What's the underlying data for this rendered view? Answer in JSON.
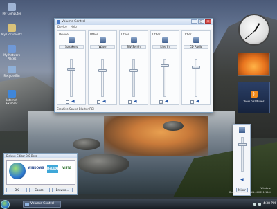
{
  "desktop_icons": [
    {
      "label": "My Computer",
      "color": "#9fb4d4"
    },
    {
      "label": "My Documents",
      "color": "#d9c27a"
    },
    {
      "label": "My Network Places",
      "color": "#6f98d6"
    },
    {
      "label": "Recycle Bin",
      "color": "#8fb0d8"
    },
    {
      "label": "Internet Explorer",
      "color": "#3f86d9"
    }
  ],
  "volume_window": {
    "title": "Volume Control",
    "menu": [
      "Device",
      "Help"
    ],
    "status": "Creative Sound Blaster PCI",
    "channels": [
      {
        "type": "Device",
        "label": "Speakers",
        "level": 0.75,
        "muted": false
      },
      {
        "type": "Other",
        "label": "Wave",
        "level": 0.7,
        "muted": false
      },
      {
        "type": "Other",
        "label": "SW Synth",
        "level": 0.7,
        "muted": false
      },
      {
        "type": "Other",
        "label": "Line In",
        "level": 0.85,
        "muted": true
      },
      {
        "type": "Other",
        "label": "CD Audio",
        "level": 0.8,
        "muted": false
      }
    ]
  },
  "gadgets": {
    "feed_label": "View headlines"
  },
  "master_volume": {
    "button": "Mixer",
    "level": 0.8
  },
  "deluxe_window": {
    "title": "Deluxe Editor 3.0 Beta",
    "logos": [
      "WINDOWS",
      "DeLUXE",
      "VISTA"
    ],
    "buttons": [
      "OK",
      "Cancel",
      "Browse..."
    ]
  },
  "watermark": {
    "line1": "Windows",
    "line2": "Build 5600.vlmp_rtl1.060621-1444"
  },
  "taskbar": {
    "task": "Volume Control",
    "time": "4:38 PM"
  }
}
